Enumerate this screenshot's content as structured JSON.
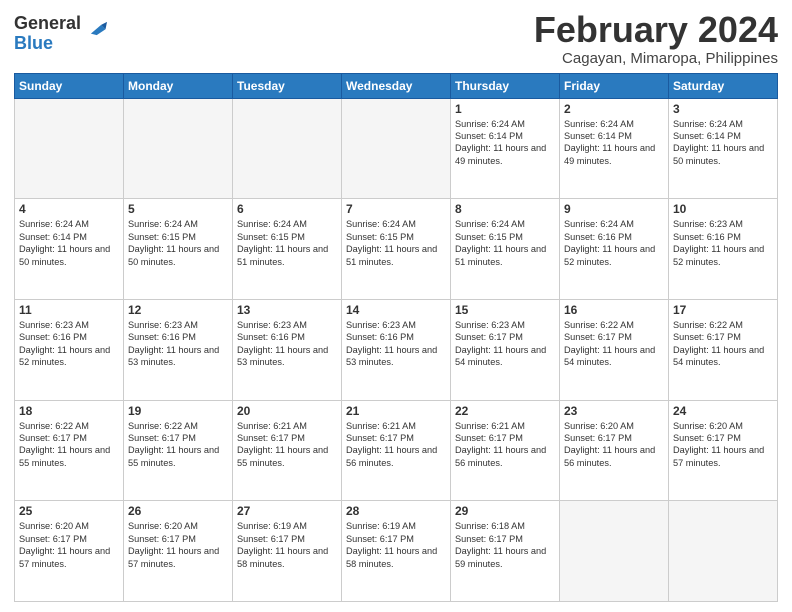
{
  "logo": {
    "general": "General",
    "blue": "Blue"
  },
  "title": "February 2024",
  "subtitle": "Cagayan, Mimaropa, Philippines",
  "headers": [
    "Sunday",
    "Monday",
    "Tuesday",
    "Wednesday",
    "Thursday",
    "Friday",
    "Saturday"
  ],
  "weeks": [
    [
      {
        "day": "",
        "info": ""
      },
      {
        "day": "",
        "info": ""
      },
      {
        "day": "",
        "info": ""
      },
      {
        "day": "",
        "info": ""
      },
      {
        "day": "1",
        "info": "Sunrise: 6:24 AM\nSunset: 6:14 PM\nDaylight: 11 hours and 49 minutes."
      },
      {
        "day": "2",
        "info": "Sunrise: 6:24 AM\nSunset: 6:14 PM\nDaylight: 11 hours and 49 minutes."
      },
      {
        "day": "3",
        "info": "Sunrise: 6:24 AM\nSunset: 6:14 PM\nDaylight: 11 hours and 50 minutes."
      }
    ],
    [
      {
        "day": "4",
        "info": "Sunrise: 6:24 AM\nSunset: 6:14 PM\nDaylight: 11 hours and 50 minutes."
      },
      {
        "day": "5",
        "info": "Sunrise: 6:24 AM\nSunset: 6:15 PM\nDaylight: 11 hours and 50 minutes."
      },
      {
        "day": "6",
        "info": "Sunrise: 6:24 AM\nSunset: 6:15 PM\nDaylight: 11 hours and 51 minutes."
      },
      {
        "day": "7",
        "info": "Sunrise: 6:24 AM\nSunset: 6:15 PM\nDaylight: 11 hours and 51 minutes."
      },
      {
        "day": "8",
        "info": "Sunrise: 6:24 AM\nSunset: 6:15 PM\nDaylight: 11 hours and 51 minutes."
      },
      {
        "day": "9",
        "info": "Sunrise: 6:24 AM\nSunset: 6:16 PM\nDaylight: 11 hours and 52 minutes."
      },
      {
        "day": "10",
        "info": "Sunrise: 6:23 AM\nSunset: 6:16 PM\nDaylight: 11 hours and 52 minutes."
      }
    ],
    [
      {
        "day": "11",
        "info": "Sunrise: 6:23 AM\nSunset: 6:16 PM\nDaylight: 11 hours and 52 minutes."
      },
      {
        "day": "12",
        "info": "Sunrise: 6:23 AM\nSunset: 6:16 PM\nDaylight: 11 hours and 53 minutes."
      },
      {
        "day": "13",
        "info": "Sunrise: 6:23 AM\nSunset: 6:16 PM\nDaylight: 11 hours and 53 minutes."
      },
      {
        "day": "14",
        "info": "Sunrise: 6:23 AM\nSunset: 6:16 PM\nDaylight: 11 hours and 53 minutes."
      },
      {
        "day": "15",
        "info": "Sunrise: 6:23 AM\nSunset: 6:17 PM\nDaylight: 11 hours and 54 minutes."
      },
      {
        "day": "16",
        "info": "Sunrise: 6:22 AM\nSunset: 6:17 PM\nDaylight: 11 hours and 54 minutes."
      },
      {
        "day": "17",
        "info": "Sunrise: 6:22 AM\nSunset: 6:17 PM\nDaylight: 11 hours and 54 minutes."
      }
    ],
    [
      {
        "day": "18",
        "info": "Sunrise: 6:22 AM\nSunset: 6:17 PM\nDaylight: 11 hours and 55 minutes."
      },
      {
        "day": "19",
        "info": "Sunrise: 6:22 AM\nSunset: 6:17 PM\nDaylight: 11 hours and 55 minutes."
      },
      {
        "day": "20",
        "info": "Sunrise: 6:21 AM\nSunset: 6:17 PM\nDaylight: 11 hours and 55 minutes."
      },
      {
        "day": "21",
        "info": "Sunrise: 6:21 AM\nSunset: 6:17 PM\nDaylight: 11 hours and 56 minutes."
      },
      {
        "day": "22",
        "info": "Sunrise: 6:21 AM\nSunset: 6:17 PM\nDaylight: 11 hours and 56 minutes."
      },
      {
        "day": "23",
        "info": "Sunrise: 6:20 AM\nSunset: 6:17 PM\nDaylight: 11 hours and 56 minutes."
      },
      {
        "day": "24",
        "info": "Sunrise: 6:20 AM\nSunset: 6:17 PM\nDaylight: 11 hours and 57 minutes."
      }
    ],
    [
      {
        "day": "25",
        "info": "Sunrise: 6:20 AM\nSunset: 6:17 PM\nDaylight: 11 hours and 57 minutes."
      },
      {
        "day": "26",
        "info": "Sunrise: 6:20 AM\nSunset: 6:17 PM\nDaylight: 11 hours and 57 minutes."
      },
      {
        "day": "27",
        "info": "Sunrise: 6:19 AM\nSunset: 6:17 PM\nDaylight: 11 hours and 58 minutes."
      },
      {
        "day": "28",
        "info": "Sunrise: 6:19 AM\nSunset: 6:17 PM\nDaylight: 11 hours and 58 minutes."
      },
      {
        "day": "29",
        "info": "Sunrise: 6:18 AM\nSunset: 6:17 PM\nDaylight: 11 hours and 59 minutes."
      },
      {
        "day": "",
        "info": ""
      },
      {
        "day": "",
        "info": ""
      }
    ]
  ]
}
